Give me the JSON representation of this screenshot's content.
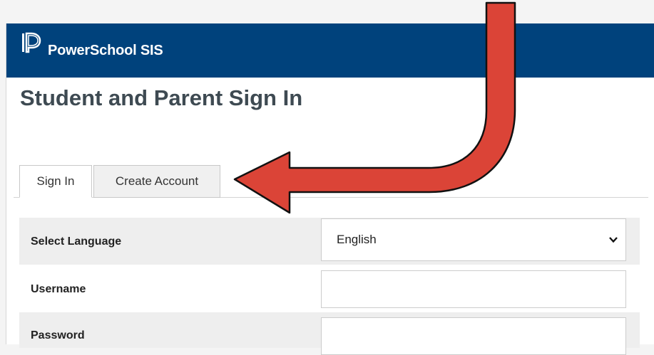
{
  "header": {
    "app_title": "PowerSchool SIS"
  },
  "page": {
    "title": "Student and Parent Sign In"
  },
  "tabs": [
    {
      "label": "Sign In",
      "active": true
    },
    {
      "label": "Create Account",
      "active": false
    }
  ],
  "form": {
    "language": {
      "label": "Select Language",
      "selected": "English"
    },
    "username": {
      "label": "Username",
      "value": ""
    },
    "password": {
      "label": "Password",
      "value": ""
    }
  },
  "colors": {
    "header_bg": "#00427c",
    "arrow_fill": "#db4437",
    "title_text": "#3e4a52"
  },
  "annotation": {
    "arrow_icon": "red-curved-arrow-icon",
    "points_to": "Create Account"
  }
}
